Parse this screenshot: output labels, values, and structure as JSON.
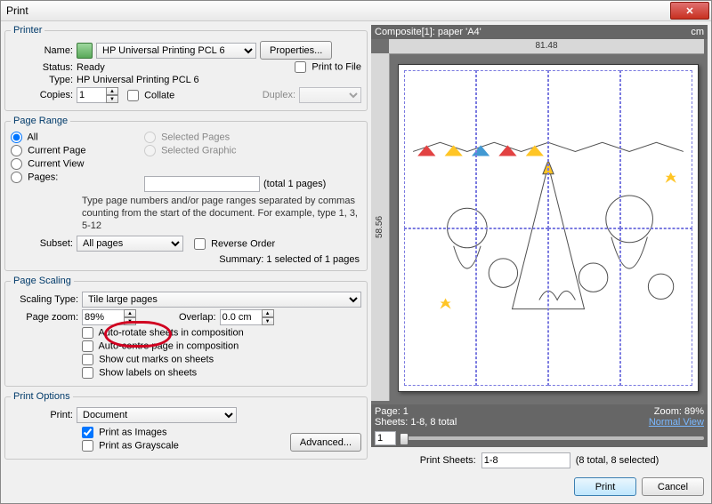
{
  "window": {
    "title": "Print"
  },
  "printer": {
    "legend": "Printer",
    "name_label": "Name:",
    "name_value": "HP Universal Printing PCL 6",
    "properties_btn": "Properties...",
    "status_label": "Status:",
    "status_value": "Ready",
    "print_to_file": "Print to File",
    "type_label": "Type:",
    "type_value": "HP Universal Printing PCL 6",
    "copies_label": "Copies:",
    "copies_value": "1",
    "collate": "Collate",
    "duplex_label": "Duplex:"
  },
  "range": {
    "legend": "Page Range",
    "all": "All",
    "current_page": "Current Page",
    "current_view": "Current View",
    "pages": "Pages:",
    "selected_pages": "Selected Pages",
    "selected_graphic": "Selected Graphic",
    "total": "(total 1 pages)",
    "help": "Type page numbers and/or page ranges separated by commas counting from the start of the document. For example, type 1, 3, 5-12",
    "subset_label": "Subset:",
    "subset_value": "All pages",
    "reverse": "Reverse Order",
    "summary": "Summary: 1 selected of 1 pages"
  },
  "scaling": {
    "legend": "Page Scaling",
    "type_label": "Scaling Type:",
    "type_value": "Tile large pages",
    "zoom_label": "Page zoom:",
    "zoom_value": "89%",
    "overlap_label": "Overlap:",
    "overlap_value": "0.0 cm",
    "auto_rotate": "Auto-rotate sheets in composition",
    "auto_centre": "Auto-centre page in composition",
    "cut_marks": "Show cut marks on sheets",
    "labels": "Show labels on sheets"
  },
  "options": {
    "legend": "Print Options",
    "print_label": "Print:",
    "print_value": "Document",
    "as_images": "Print as Images",
    "grayscale": "Print as Grayscale",
    "advanced": "Advanced..."
  },
  "preview": {
    "header": "Composite[1]: paper 'A4'",
    "unit": "cm",
    "width": "81.48",
    "height": "58.56",
    "page_label": "Page: 1",
    "zoom_label": "Zoom: 89%",
    "sheets_label": "Sheets: 1-8, 8 total",
    "normal_view": "Normal View",
    "slider_value": "1",
    "print_sheets_label": "Print Sheets:",
    "print_sheets_value": "1-8",
    "print_sheets_info": "(8 total, 8 selected)"
  },
  "buttons": {
    "print": "Print",
    "cancel": "Cancel"
  }
}
